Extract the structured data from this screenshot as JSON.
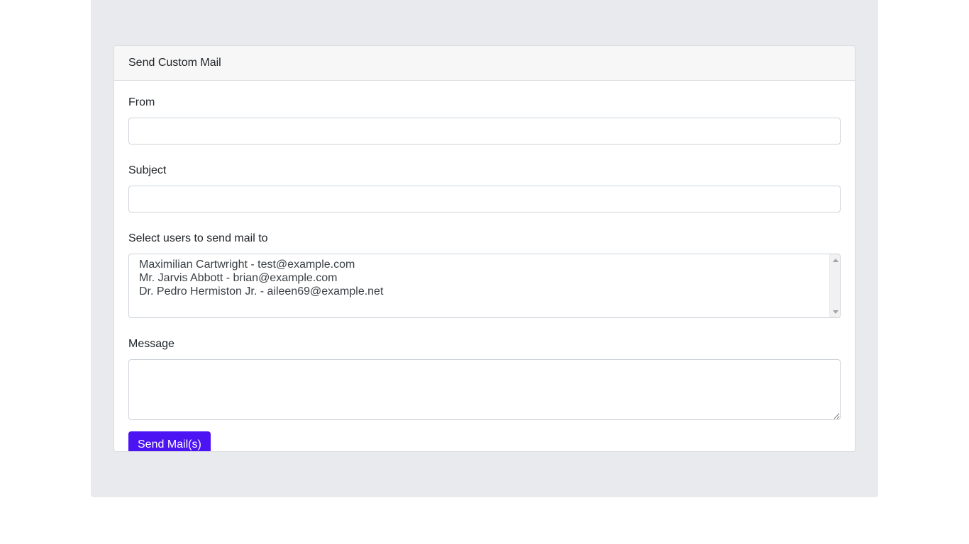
{
  "form": {
    "title": "Send Custom Mail",
    "from": {
      "label": "From",
      "value": ""
    },
    "subject": {
      "label": "Subject",
      "value": ""
    },
    "recipients": {
      "label": "Select users to send mail to",
      "options": [
        "Maximilian Cartwright - test@example.com",
        "Mr. Jarvis Abbott - brian@example.com",
        "Dr. Pedro Hermiston Jr. - aileen69@example.net"
      ]
    },
    "message": {
      "label": "Message",
      "value": ""
    },
    "submit_label": "Send Mail(s)"
  },
  "colors": {
    "primary_button": "#4c13f3",
    "page_panel": "#e9eaee",
    "card_header": "#f7f7f7"
  }
}
